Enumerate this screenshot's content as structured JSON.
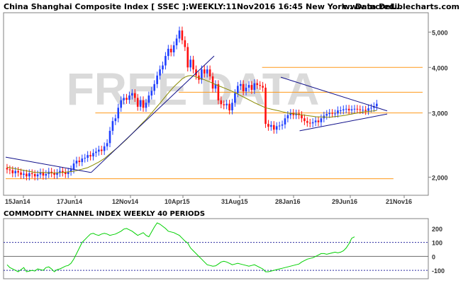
{
  "header": {
    "title": "China Shanghai Composite Index [ SSEC ]:WEEKLY:11Nov2016 16:45 New York : Data Del...",
    "site": "www.incrediblecharts.com"
  },
  "watermark": "FREE DATA",
  "colors": {
    "up": "#1f3fff",
    "down": "#ff1010",
    "ma": "#8a8a00",
    "trend": "#10108a",
    "support": "#ff9a1a",
    "cci": "#00d000",
    "grid_dotted": "#2a2aa0",
    "frame": "#808080"
  },
  "chart_data": [
    {
      "type": "candlestick",
      "title": "China Shanghai Composite Index [ SSEC ]:WEEKLY:11Nov2016 16:45 New York : Data Del...",
      "x_labels": [
        "15Jan14",
        "17Jun14",
        "12Nov14",
        "10Apr15",
        "31Aug15",
        "28Jan16",
        "29Jun16",
        "21Nov16"
      ],
      "y_tick_labels": [
        "2,000",
        "3,000",
        "4,000",
        "5,000"
      ],
      "y_ticks": [
        2000,
        3000,
        4000,
        5000
      ],
      "y_scale": "log",
      "ylim": [
        1800,
        5600
      ],
      "series": [
        {
          "kind": "close",
          "values": [
            2100,
            2090,
            2050,
            2080,
            2060,
            2030,
            2045,
            2010,
            2050,
            2040,
            2010,
            2035,
            2060,
            2020,
            2040,
            2070,
            2050,
            2030,
            2055,
            2080,
            2060,
            2040,
            2070,
            2100,
            2180,
            2220,
            2200,
            2250,
            2260,
            2300,
            2280,
            2330,
            2350,
            2380,
            2360,
            2430,
            2480,
            2680,
            2850,
            2900,
            3100,
            3250,
            3300,
            3260,
            3350,
            3400,
            3300,
            3120,
            3250,
            3100,
            3200,
            3350,
            3450,
            3600,
            3800,
            3950,
            4050,
            4300,
            4500,
            4400,
            4600,
            4800,
            5050,
            4750,
            4550,
            4000,
            4200,
            3950,
            3800,
            3700,
            3950,
            3850,
            3950,
            3780,
            3500,
            3600,
            3250,
            3170,
            3150,
            3180,
            3050,
            3200,
            3400,
            3560,
            3600,
            3440,
            3520,
            3580,
            3470,
            3620,
            3580,
            3560,
            3520,
            2800,
            2750,
            2780,
            2700,
            2760,
            2770,
            2790,
            2900,
            2960,
            3000,
            2960,
            2990,
            2960,
            2900,
            2850,
            2820,
            2810,
            2830,
            2860,
            2830,
            2900,
            2950,
            2980,
            3000,
            2990,
            2990,
            3050,
            3050,
            3070,
            3080,
            3050,
            3070,
            3080,
            3070,
            3060,
            3060,
            3040,
            3090,
            3100,
            3130,
            3180
          ]
        },
        {
          "kind": "moving_average",
          "values": [
            2130,
            2123,
            2116,
            2109,
            2102,
            2095,
            2088,
            2081,
            2074,
            2067,
            2060,
            2060,
            2060,
            2060,
            2058,
            2056,
            2055,
            2054,
            2055,
            2058,
            2061,
            2064,
            2068,
            2072,
            2077,
            2084,
            2094,
            2104,
            2114,
            2124,
            2142,
            2160,
            2180,
            2200,
            2225,
            2250,
            2283,
            2317,
            2350,
            2385,
            2420,
            2460,
            2500,
            2540,
            2586,
            2633,
            2680,
            2730,
            2780,
            2830,
            2880,
            2940,
            3000,
            3060,
            3125,
            3190,
            3260,
            3330,
            3400,
            3470,
            3540,
            3600,
            3660,
            3720,
            3760,
            3790,
            3800,
            3790,
            3770,
            3745,
            3720,
            3700,
            3675,
            3650,
            3620,
            3590,
            3565,
            3540,
            3515,
            3490,
            3465,
            3440,
            3410,
            3380,
            3350,
            3320,
            3290,
            3260,
            3230,
            3200,
            3175,
            3150,
            3125,
            3100,
            3087,
            3075,
            3062,
            3050,
            3038,
            3025,
            3012,
            3000,
            2993,
            2986,
            2979,
            2972,
            2965,
            2958,
            2951,
            2944,
            2937,
            2930,
            2928,
            2926,
            2924,
            2922,
            2920,
            2926,
            2932,
            2938,
            2944,
            2950,
            2960,
            2970,
            2980,
            2990,
            3000,
            3010,
            3020,
            3025,
            3030,
            3035,
            3040,
            3045
          ]
        },
        {
          "kind": "support_line",
          "y": 1980,
          "x_end_frac": 0.93
        },
        {
          "kind": "support_line",
          "y": 3000,
          "x_start_frac": 0.215
        },
        {
          "kind": "support_line",
          "y": 3420,
          "x_start_frac": 0.415
        },
        {
          "kind": "support_line",
          "y": 4000,
          "x_start_frac": 0.615
        },
        {
          "kind": "trendline",
          "from": [
            0.0,
            2270
          ],
          "to": [
            0.205,
            2060
          ]
        },
        {
          "kind": "trendline",
          "from": [
            0.205,
            2060
          ],
          "to": [
            0.5,
            4300
          ]
        },
        {
          "kind": "trendline",
          "from": [
            0.66,
            3760
          ],
          "to": [
            0.915,
            3040
          ]
        },
        {
          "kind": "trendline",
          "from": [
            0.705,
            2680
          ],
          "to": [
            0.915,
            2980
          ]
        }
      ]
    },
    {
      "type": "line",
      "title": "COMMODITY CHANNEL INDEX WEEKLY 40 PERIODS",
      "y_tick_labels": [
        "200",
        "100",
        "0",
        "-100"
      ],
      "y_ticks": [
        200,
        100,
        0,
        -100
      ],
      "ylim": [
        -150,
        260
      ],
      "reference_lines": [
        100,
        0,
        -100
      ],
      "values": [
        -60,
        -80,
        -90,
        -100,
        -110,
        -95,
        -80,
        -110,
        -105,
        -100,
        -105,
        -90,
        -95,
        -100,
        -80,
        -75,
        -90,
        -110,
        -95,
        -90,
        -80,
        -70,
        -65,
        -50,
        -20,
        20,
        60,
        100,
        120,
        140,
        160,
        165,
        155,
        150,
        160,
        165,
        160,
        150,
        155,
        160,
        170,
        180,
        195,
        200,
        190,
        180,
        165,
        150,
        160,
        170,
        150,
        140,
        175,
        210,
        240,
        230,
        215,
        200,
        180,
        175,
        170,
        160,
        150,
        130,
        110,
        95,
        60,
        40,
        20,
        0,
        -20,
        -40,
        -60,
        -65,
        -70,
        -68,
        -55,
        -40,
        -35,
        -40,
        -50,
        -60,
        -55,
        -50,
        -55,
        -60,
        -65,
        -70,
        -65,
        -60,
        -70,
        -80,
        -90,
        -110,
        -110,
        -105,
        -100,
        -95,
        -90,
        -85,
        -80,
        -75,
        -70,
        -65,
        -60,
        -55,
        -40,
        -30,
        -20,
        -15,
        -10,
        0,
        10,
        20,
        20,
        15,
        20,
        25,
        30,
        25,
        30,
        40,
        60,
        90,
        130,
        140
      ]
    }
  ]
}
